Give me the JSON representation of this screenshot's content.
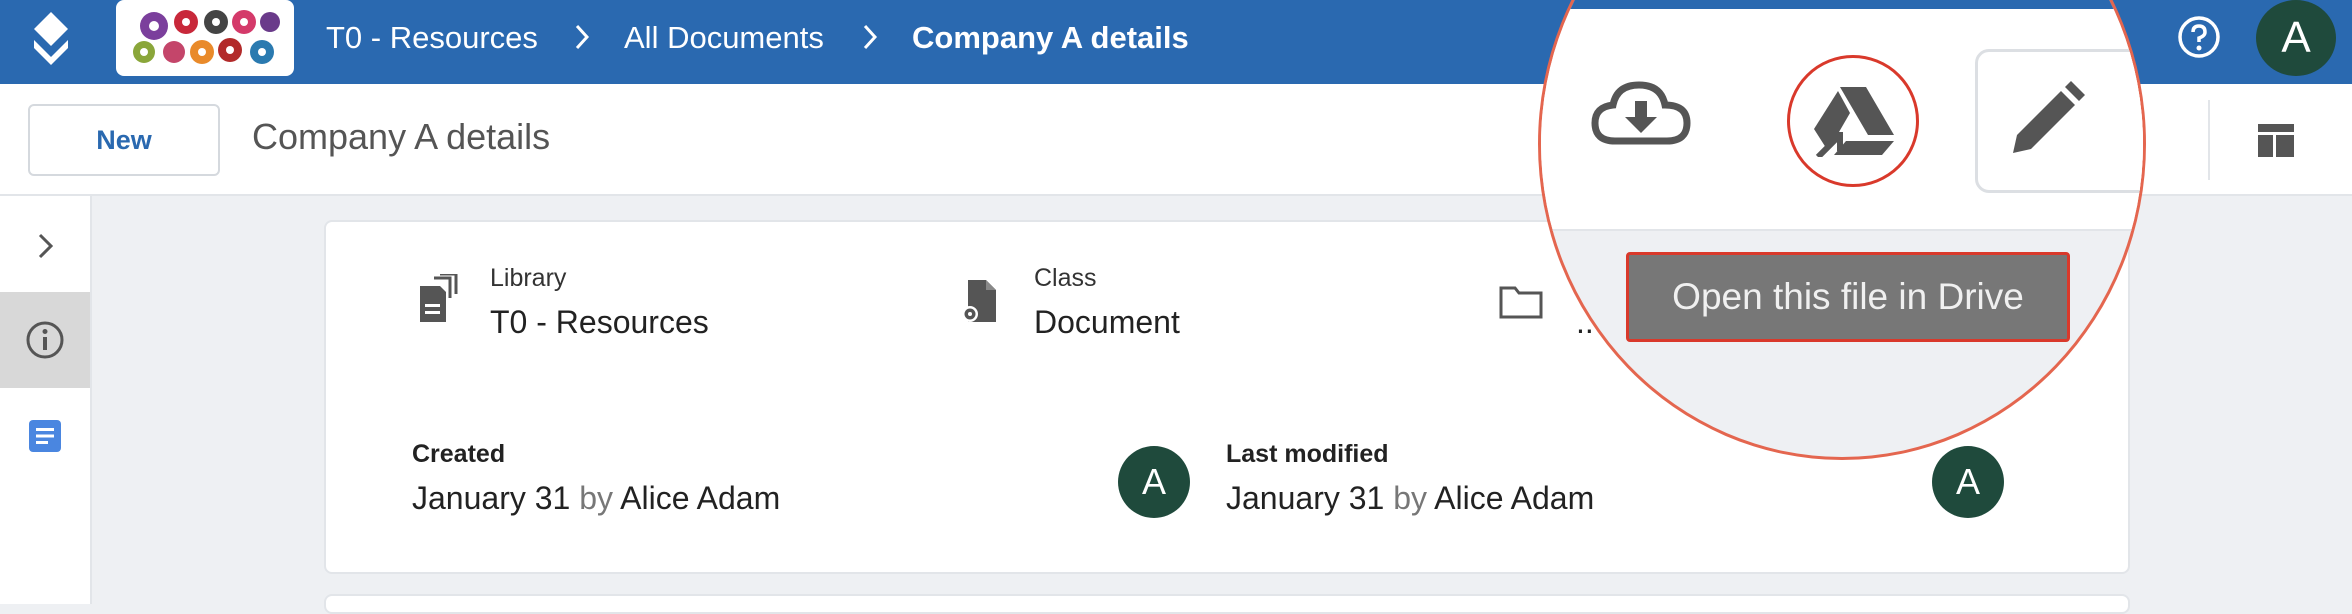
{
  "header": {
    "breadcrumbs": [
      "T0 - Resources",
      "All Documents",
      "Company A details"
    ],
    "avatar_initial": "A"
  },
  "toolbar": {
    "new_label": "New",
    "document_title": "Company A details"
  },
  "metadata": {
    "library_label": "Library",
    "library_value": "T0 - Resources",
    "class_label": "Class",
    "class_value": "Document",
    "folder_value": "..",
    "created_label": "Created",
    "created_date": "January 31",
    "created_by_word": "by",
    "created_by": "Alice Adam",
    "created_avatar": "A",
    "modified_label": "Last modified",
    "modified_date": "January 31",
    "modified_by_word": "by",
    "modified_by": "Alice Adam",
    "modified_avatar": "A"
  },
  "magnifier": {
    "tooltip": "Open this file in Drive",
    "buttons": [
      "cloud-download-icon",
      "google-drive-icon",
      "pencil-icon"
    ]
  },
  "colors": {
    "header_blue": "#2a69b0",
    "avatar_green": "#1f4a3c",
    "highlight_red": "#d9392b"
  }
}
